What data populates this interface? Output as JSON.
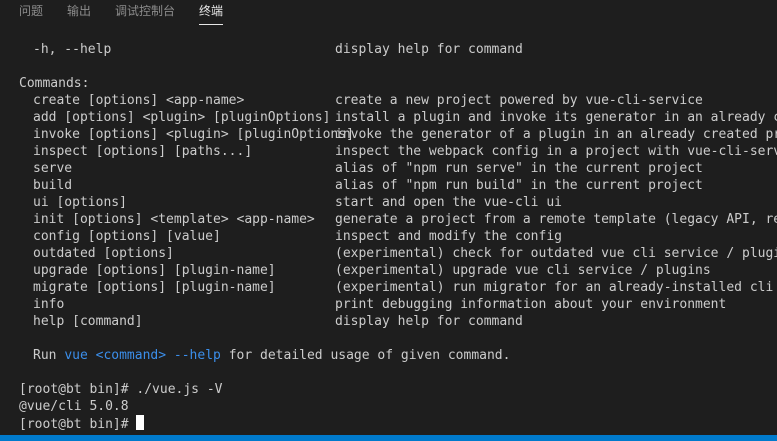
{
  "tabs": {
    "problems": "问题",
    "output": "输出",
    "debug_console": "调试控制台",
    "terminal": "终端"
  },
  "terminal": {
    "help_option": {
      "cmd": "-h, --help",
      "desc": "display help for command"
    },
    "commands_header": "Commands:",
    "commands": [
      {
        "cmd": "create [options] <app-name>",
        "desc": "create a new project powered by vue-cli-service"
      },
      {
        "cmd": "add [options] <plugin> [pluginOptions]",
        "desc": "install a plugin and invoke its generator in an already created"
      },
      {
        "cmd": "invoke [options] <plugin> [pluginOptions]",
        "desc": "invoke the generator of a plugin in an already created project"
      },
      {
        "cmd": "inspect [options] [paths...]",
        "desc": "inspect the webpack config in a project with vue-cli-service"
      },
      {
        "cmd": "serve",
        "desc": "alias of \"npm run serve\" in the current project"
      },
      {
        "cmd": "build",
        "desc": "alias of \"npm run build\" in the current project"
      },
      {
        "cmd": "ui [options]",
        "desc": "start and open the vue-cli ui"
      },
      {
        "cmd": "init [options] <template> <app-name>",
        "desc": "generate a project from a remote template (legacy API, requires"
      },
      {
        "cmd": "config [options] [value]",
        "desc": "inspect and modify the config"
      },
      {
        "cmd": "outdated [options]",
        "desc": "(experimental) check for outdated vue cli service / plugins"
      },
      {
        "cmd": "upgrade [options] [plugin-name]",
        "desc": "(experimental) upgrade vue cli service / plugins"
      },
      {
        "cmd": "migrate [options] [plugin-name]",
        "desc": "(experimental) run migrator for an already-installed cli plugin"
      },
      {
        "cmd": "info",
        "desc": "print debugging information about your environment"
      },
      {
        "cmd": "help [command]",
        "desc": "display help for command"
      }
    ],
    "run_hint": {
      "prefix": "Run ",
      "vue": "vue",
      "command": "<command>",
      "help": "--help",
      "suffix": " for detailed usage of given command."
    },
    "prompt1": "[root@bt bin]# ./vue.js -V",
    "version": "@vue/cli 5.0.8",
    "prompt2": "[root@bt bin]# "
  },
  "colors": {
    "background": "#1e1e1e",
    "text": "#cccccc",
    "highlight": "#3b8eea",
    "status_bar": "#007acc"
  }
}
